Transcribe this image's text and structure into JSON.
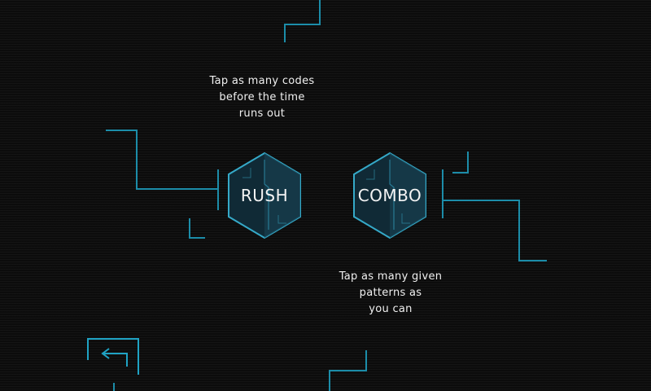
{
  "modes": {
    "rush": {
      "label": "RUSH",
      "description": [
        "Tap as many codes",
        "before the time",
        "runs out"
      ]
    },
    "combo": {
      "label": "COMBO",
      "description": [
        "Tap as many given",
        "patterns as",
        "you can"
      ]
    }
  },
  "navigation": {
    "back_icon": "back-arrow-icon"
  },
  "colors": {
    "background": "#0c0c0c",
    "circuit_line": "#1fa3c4",
    "hex_border": "#35a9c8",
    "hex_fill_dark": "#102a36",
    "hex_fill_light": "#153a4a",
    "text": "#f0f0f0"
  }
}
